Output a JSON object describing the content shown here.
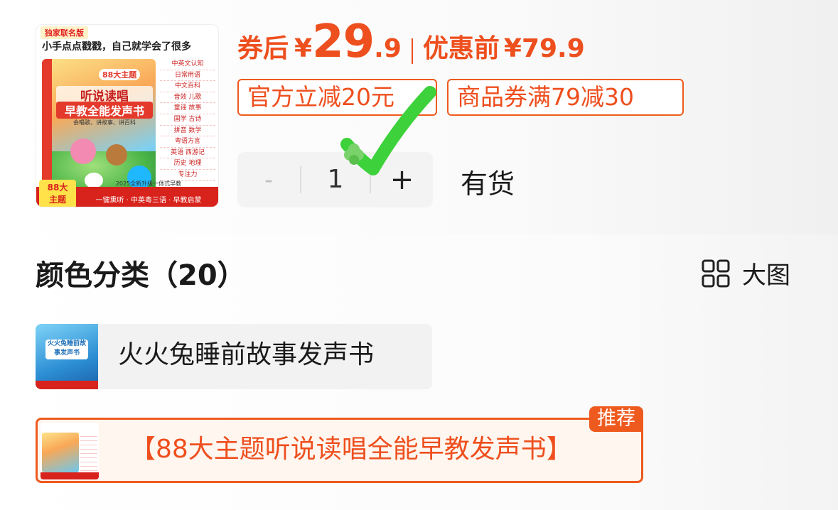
{
  "product": {
    "cover": {
      "badge": "独家联名版",
      "headline": "小手点点戳戳，自己就学会了很多",
      "book_tag": "88大主题",
      "book_title_1": "听说读唱",
      "book_title_2": "早教全能发声书",
      "book_subtitle": "会唱歌、讲故事、讲百科",
      "topics": [
        "中英文认知",
        "日常用语",
        "中文百科",
        "音效 儿歌",
        "童谣 故事",
        "国学 古诗",
        "拼音 数学",
        "粤语方言",
        "英语 西游记",
        "历史 地理",
        "专注力"
      ],
      "corner_tag_1": "88大",
      "corner_tag_2": "主题",
      "upgrade_note": "2025全新升级一体式早教",
      "slogan": "一键熏听 · 中英粤三语 · 早教启蒙"
    }
  },
  "price": {
    "after_coupon_label": "券后",
    "currency": "¥",
    "after_coupon_int": "29",
    "after_coupon_dec": ".9",
    "before_label": "优惠前",
    "before_price": "¥79.9"
  },
  "coupons": [
    {
      "label": "官方立减20元"
    },
    {
      "label": "商品券满79减30"
    }
  ],
  "quantity": {
    "minus": "-",
    "value": "1",
    "plus": "+",
    "stock_status": "有货"
  },
  "variants": {
    "title": "颜色分类（20）",
    "view_toggle_label": "大图",
    "view_toggle_icon": "grid-icon",
    "options": [
      {
        "label": "火火兔睡前故事发声书",
        "thumb_text": "火火兔睡前故事发声书",
        "selected": false
      },
      {
        "label": "【88大主题听说读唱全能早教发声书】",
        "selected": true,
        "badge": "推荐"
      }
    ]
  },
  "colors": {
    "accent": "#ee4f1e",
    "check": "#3dd13b",
    "option_bg": "#f2f2f2"
  }
}
